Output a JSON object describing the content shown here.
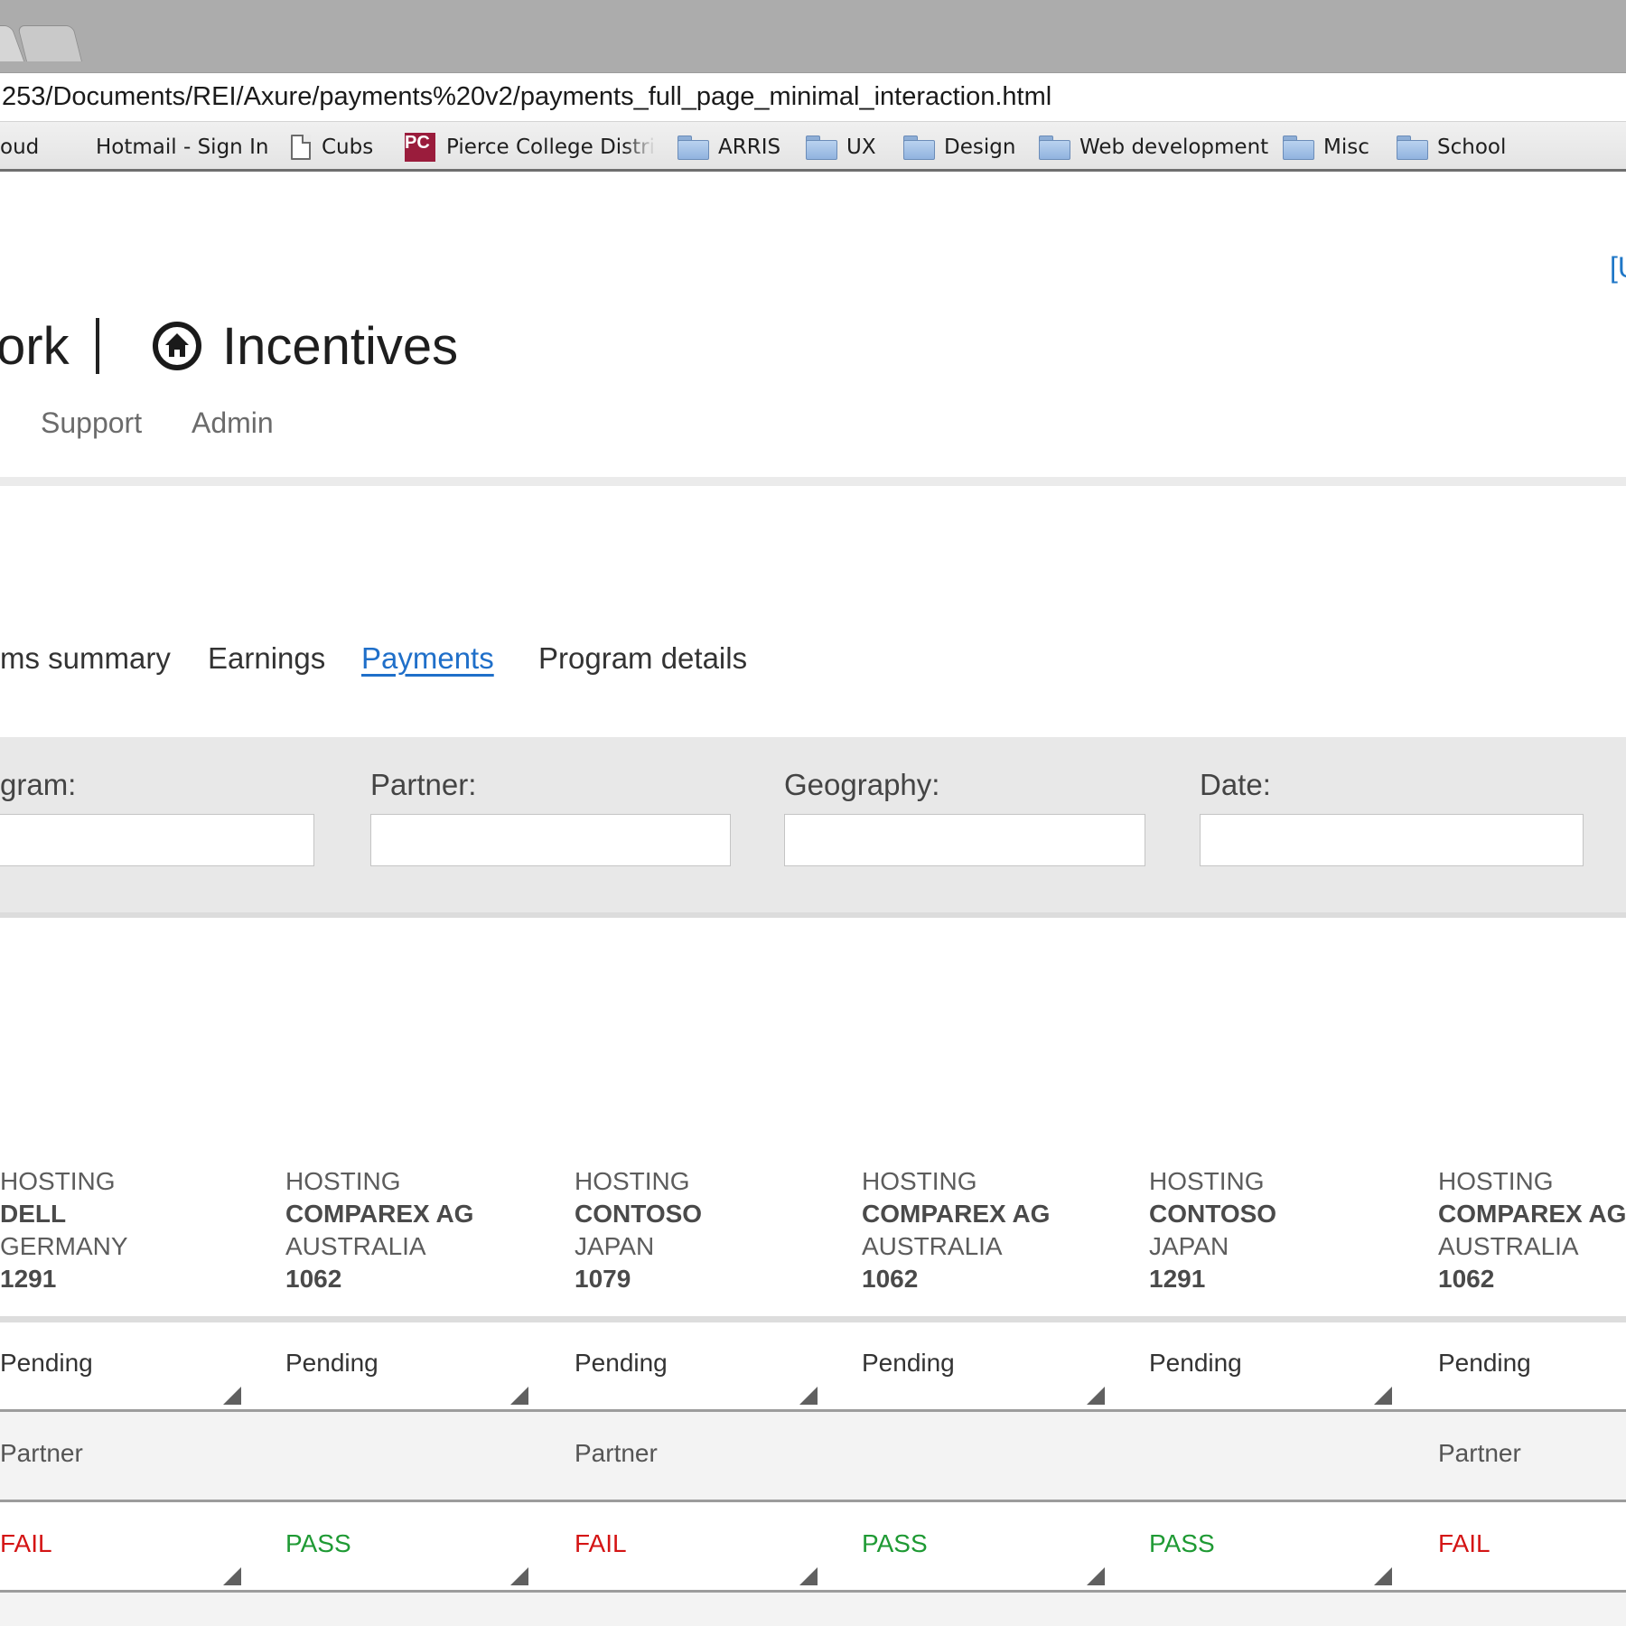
{
  "browser": {
    "url": "253/Documents/REI/Axure/payments%20v2/payments_full_page_minimal_interaction.html",
    "bookmarks": [
      {
        "label": "oud",
        "icon": "none"
      },
      {
        "label": "Hotmail - Sign In",
        "icon": "microsoft-logo-icon"
      },
      {
        "label": "Cubs",
        "icon": "page-icon"
      },
      {
        "label": "Pierce College Distric",
        "icon": "pierce-college-icon",
        "badge": "PC"
      },
      {
        "label": "ARRIS",
        "icon": "folder-icon"
      },
      {
        "label": "UX",
        "icon": "folder-icon"
      },
      {
        "label": "Design",
        "icon": "folder-icon"
      },
      {
        "label": "Web development",
        "icon": "folder-icon"
      },
      {
        "label": "Misc",
        "icon": "folder-icon"
      },
      {
        "label": "School",
        "icon": "folder-icon"
      }
    ]
  },
  "header": {
    "user_link": "[U",
    "brand_prefix": "ork",
    "brand_title": "Incentives",
    "brand_icon": "home-circle-icon",
    "nav": [
      "Support",
      "Admin"
    ]
  },
  "subnav": {
    "tabs": [
      {
        "label": "ms summary",
        "active": false
      },
      {
        "label": "Earnings",
        "active": false
      },
      {
        "label": "Payments",
        "active": true
      },
      {
        "label": "Program details",
        "active": false
      }
    ]
  },
  "filters": [
    {
      "label": "gram:",
      "value": ""
    },
    {
      "label": "Partner:",
      "value": ""
    },
    {
      "label": "Geography:",
      "value": ""
    },
    {
      "label": "Date:",
      "value": ""
    }
  ],
  "columns": [
    {
      "program": "HOSTING",
      "partner": "DELL",
      "geography": "GERMANY",
      "id": "1291",
      "status": "Pending",
      "type": "Partner",
      "result": "FAIL"
    },
    {
      "program": "HOSTING",
      "partner": "COMPAREX AG",
      "geography": "AUSTRALIA",
      "id": "1062",
      "status": "Pending",
      "type": "",
      "result": "PASS"
    },
    {
      "program": "HOSTING",
      "partner": "CONTOSO",
      "geography": "JAPAN",
      "id": "1079",
      "status": "Pending",
      "type": "Partner",
      "result": "FAIL"
    },
    {
      "program": "HOSTING",
      "partner": "COMPAREX AG",
      "geography": "AUSTRALIA",
      "id": "1062",
      "status": "Pending",
      "type": "",
      "result": "PASS"
    },
    {
      "program": "HOSTING",
      "partner": "CONTOSO",
      "geography": "JAPAN",
      "id": "1291",
      "status": "Pending",
      "type": "",
      "result": "PASS"
    },
    {
      "program": "HOSTING",
      "partner": "COMPAREX AG",
      "geography": "AUSTRALIA",
      "id": "1062",
      "status": "Pending",
      "type": "Partner",
      "result": "FAIL"
    }
  ],
  "colors": {
    "link": "#1f6fc9",
    "pass": "#1f9a34",
    "fail": "#d41414",
    "microsoft": [
      "#f25022",
      "#7fba00",
      "#00a4ef",
      "#ffb900"
    ]
  }
}
